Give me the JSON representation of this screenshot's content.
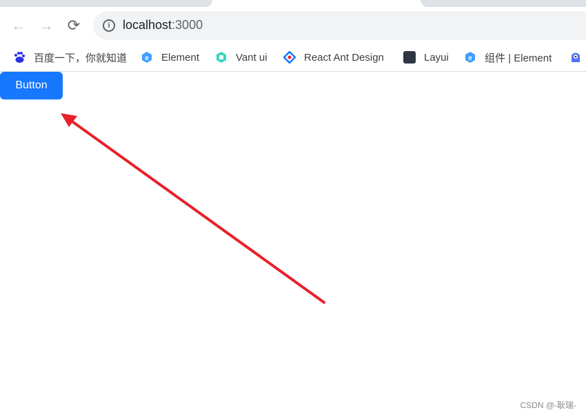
{
  "browser": {
    "url_host": "localhost",
    "url_port": ":3000",
    "bookmarks": [
      {
        "label": "百度一下，你就知道",
        "icon": "baidu-paw-icon"
      },
      {
        "label": "Element",
        "icon": "element-hexagon-icon"
      },
      {
        "label": "Vant ui",
        "icon": "vant-icon"
      },
      {
        "label": "React Ant Design",
        "icon": "antd-diamond-icon"
      },
      {
        "label": "Layui",
        "icon": "layui-icon"
      },
      {
        "label": "组件 | Element",
        "icon": "element-hexagon-icon"
      },
      {
        "label": "",
        "icon": "monster-icon"
      }
    ]
  },
  "page": {
    "button_label": "Button"
  },
  "annotation": {
    "arrow_color": "#e8202a"
  },
  "watermark": "CSDN @-耿瑞-"
}
